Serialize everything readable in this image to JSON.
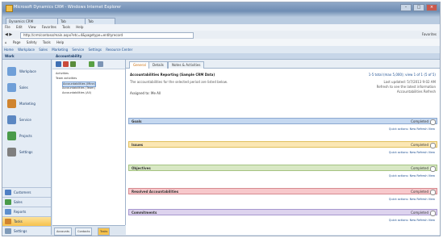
{
  "window": {
    "title": "Microsoft Dynamics CRM - Windows Internet Explorer"
  },
  "browser_tabs": [
    "Dynamics CRM",
    "Tab",
    "Tab"
  ],
  "menu": [
    "File",
    "Edit",
    "View",
    "Favorites",
    "Tools",
    "Help"
  ],
  "address": {
    "url": "http://crm/contoso/main.aspx?etc=4&pagetype=entityrecord",
    "right_label": "Favorites"
  },
  "toolbar_items": [
    "Page",
    "Safety",
    "Tools",
    "Help"
  ],
  "favorites": [
    "Home",
    "Workplace",
    "Sales",
    "Marketing",
    "Service",
    "Settings",
    "Resource Center"
  ],
  "app": {
    "left_title": "Work",
    "right_title": "Accountability"
  },
  "leftnav": {
    "items": [
      {
        "label": "Workplace",
        "color": "#6f9fd8"
      },
      {
        "label": "Sales",
        "color": "#6f9fd8"
      },
      {
        "label": "Marketing",
        "color": "#d0842f"
      },
      {
        "label": "Service",
        "color": "#5b87c2"
      },
      {
        "label": "Projects",
        "color": "#4a9b4a"
      },
      {
        "label": "Settings",
        "color": "#7f7f7f"
      }
    ],
    "bottom": [
      {
        "label": "Customers",
        "color": "#4f7fc4"
      },
      {
        "label": "Sales",
        "color": "#4a9b4a"
      },
      {
        "label": "Reports",
        "color": "#5e8fce"
      },
      {
        "label": "Tasks",
        "color": "#d0842f",
        "selected": true
      },
      {
        "label": "Settings",
        "color": "#7f9ab8"
      }
    ]
  },
  "tree": {
    "nodes": [
      {
        "label": "Activities",
        "level": 1
      },
      {
        "label": "Team activities",
        "level": 1
      },
      {
        "label": "Accountabilities (Mine)",
        "level": 2,
        "selected": true
      },
      {
        "label": "Accountabilities (Team)",
        "level": 2
      },
      {
        "label": "Accountabilities (All)",
        "level": 2
      }
    ],
    "bottom_tabs": [
      "Accounts",
      "Contacts",
      "Tasks"
    ]
  },
  "content": {
    "tabs": [
      "General",
      "Details",
      "Notes & Activities"
    ],
    "title": "Accountabilities Reporting (Sample CRM Data)",
    "title_right": "1-5 total (max 5,000); view 1 of 1 (5 of 5)",
    "subtitle": "The accountabilities for the selected period are listed below.",
    "assigned": "Assigned to: Me    All",
    "right_info": [
      "Last updated: 5/7/2013 9:02 AM",
      "Refresh to see the latest information",
      "Accountabilities Refresh"
    ],
    "sections": [
      {
        "label": "Goals",
        "right": "Completed",
        "sub": "Quick actions: New  Refresh  View",
        "bg": "#c5d8f0",
        "border": "#8ba8d0"
      },
      {
        "label": "Issues",
        "right": "Completed",
        "sub": "Quick actions: New  Refresh  View",
        "bg": "#fbe7b4",
        "border": "#e0bf5c"
      },
      {
        "label": "Objectives",
        "right": "Completed",
        "sub": "Quick actions: New  Refresh  View",
        "bg": "#d8e8c4",
        "border": "#a5c382"
      },
      {
        "label": "Resolved Accountabilities",
        "right": "Completed",
        "sub": "Quick actions: New  Refresh  View",
        "bg": "#f7c8cb",
        "border": "#d68b91"
      },
      {
        "label": "Commitments",
        "right": "Completed",
        "sub": "Quick actions: New  Refresh  View",
        "bg": "#ddd3ee",
        "border": "#a797cf"
      }
    ]
  }
}
